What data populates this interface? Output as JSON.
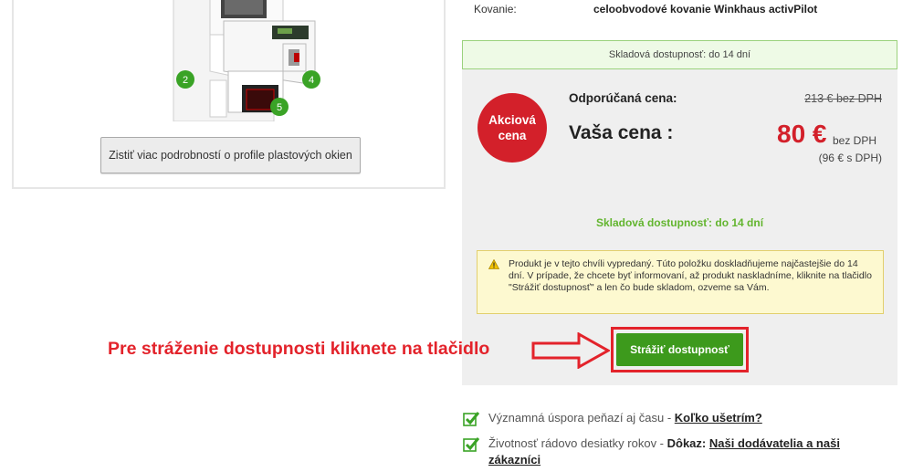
{
  "product": {
    "profile_markers": [
      "2",
      "4",
      "5"
    ],
    "details_button": "Zistiť viac podrobností o profile plastových okien"
  },
  "spec": {
    "label": "Kovanie:",
    "value": "celoobvodové kovanie Winkhaus activPilot"
  },
  "stock": {
    "top_text": "Skladová dostupnosť: do 14 dní",
    "green_text": "Skladová dostupnosť: do 14 dní"
  },
  "price": {
    "badge_line1": "Akciová",
    "badge_line2": "cena",
    "recommended_label": "Odporúčaná cena:",
    "recommended_value": "213 € bez DPH",
    "your_label": "Vaša cena :",
    "main_value": "80 €",
    "main_note": "bez DPH",
    "with_vat": "(96 € s DPH)"
  },
  "warning": {
    "icon": "warning-icon",
    "text": "Produkt je v tejto chvíli vypredaný. Túto položku doskladňujeme najčastejšie do 14 dní. V prípade, že chcete byť informovaní, až produkt naskladníme, kliknite na tlačidlo \"Strážiť dostupnosť\" a len čo bude skladom, ozveme sa Vám."
  },
  "watch_button": "Strážiť dostupnosť",
  "annotation": "Pre stráženie dostupnosti kliknete na tlačidlo",
  "benefits": [
    {
      "text": "Významná úspora peňazí aj času - ",
      "bold": "",
      "link": "Koľko ušetrím?"
    },
    {
      "text": "Životnosť rádovo desiatky rokov - ",
      "bold": "Dôkaz:",
      "link": "Naši dodávatelia a naši zákazníci"
    }
  ],
  "colors": {
    "sale_red": "#d3202a",
    "button_green": "#3d9a1c",
    "stock_green": "#62b52e",
    "annotation_red": "#e3232b"
  }
}
